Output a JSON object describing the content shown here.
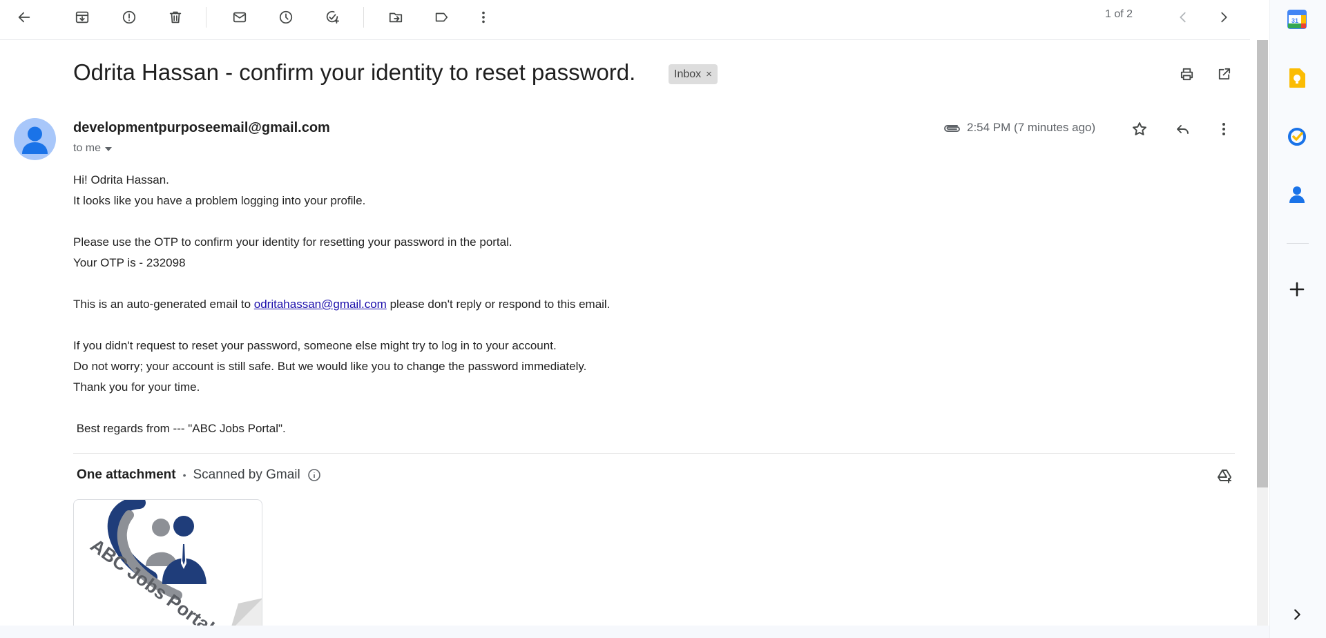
{
  "toolbar": {
    "back_icon": "arrow-back-icon",
    "archive_icon": "archive-icon",
    "report_spam_icon": "report-spam-icon",
    "delete_icon": "delete-icon",
    "mark_unread_icon": "mail-icon",
    "snooze_icon": "clock-icon",
    "add_task_icon": "add-task-icon",
    "move_to_icon": "move-to-icon",
    "label_icon": "label-icon",
    "more_icon": "more-vert-icon",
    "pager_text": "1 of 2"
  },
  "email": {
    "subject": "Odrita Hassan - confirm your identity to reset password.",
    "label_chip": "Inbox",
    "label_chip_close": "×",
    "sender": "developmentpurposeemail@gmail.com",
    "recipient": "to me",
    "time": "2:54 PM (7 minutes ago)",
    "body": {
      "line1": "Hi! Odrita Hassan.",
      "line2": "It looks like you have a problem logging into your profile.",
      "line3": "Please use the OTP to confirm your identity for resetting your password in the portal.",
      "line4": "Your OTP is - 232098",
      "line5_before": "This is an auto-generated email to ",
      "line5_link": "odritahassan@gmail.com",
      "line5_after": " please don't reply or respond to this email.",
      "line6": "If you didn't request to reset your password, someone else might try to log in to your account.",
      "line7": "Do not worry; your account is still safe. But we would like you to change the password immediately.",
      "line8": "Thank you for your time.",
      "line9": " Best regards from --- \"ABC Jobs Portal\"."
    }
  },
  "attachments": {
    "heading": "One attachment",
    "separator": "•",
    "scanned": "Scanned by Gmail",
    "thumbnail_logo_text": "ABC Jobs Portal"
  },
  "side_panel": {
    "calendar_day": "31",
    "items": [
      "calendar-icon",
      "keep-icon",
      "tasks-icon",
      "contacts-icon",
      "add-icon",
      "chevron-right-icon"
    ]
  },
  "colors": {
    "accent_blue": "#1a73e8",
    "link": "#1a0dab",
    "keep_yellow": "#fbbc04",
    "avatar_bg": "#a8c7fa",
    "logo_navy": "#1f3d7a"
  }
}
